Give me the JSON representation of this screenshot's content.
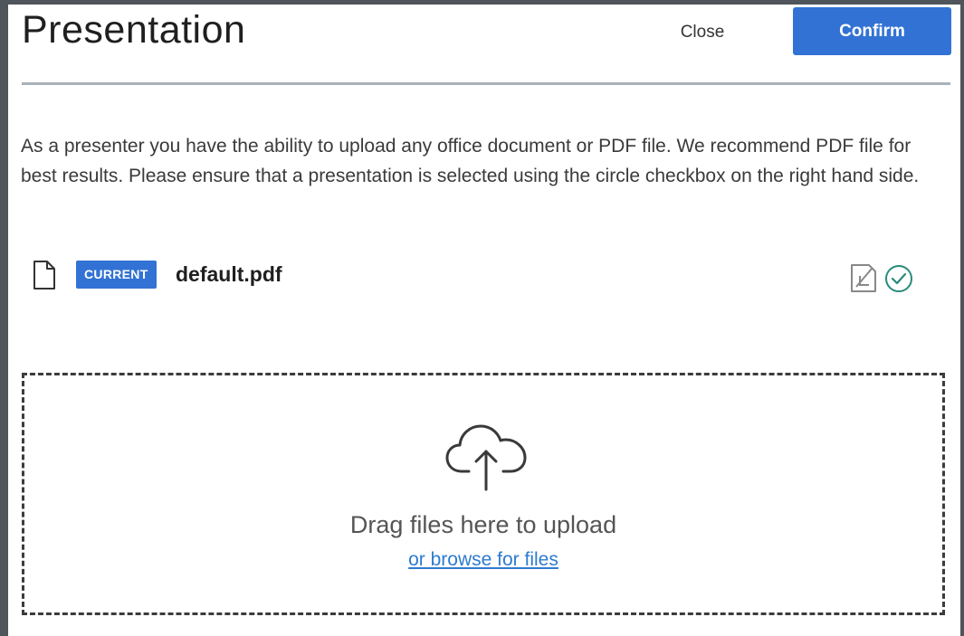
{
  "modal": {
    "title": "Presentation",
    "close_label": "Close",
    "confirm_label": "Confirm",
    "instructions": "As a presenter you have the ability to upload any office document or PDF file. We recommend PDF file for best results. Please ensure that a presentation is selected using the circle checkbox on the right hand side."
  },
  "files": [
    {
      "badge": "CURRENT",
      "name": "default.pdf",
      "icon": "file-icon",
      "actions": [
        "download-icon",
        "check-circle-icon"
      ]
    }
  ],
  "dropzone": {
    "icon": "cloud-upload-icon",
    "text": "Drag files here to upload",
    "browse_label": "or browse for files"
  },
  "colors": {
    "accent": "#3272d4",
    "link": "#2d7bcf",
    "check": "#2a8a7a",
    "frame": "#4f555b"
  }
}
